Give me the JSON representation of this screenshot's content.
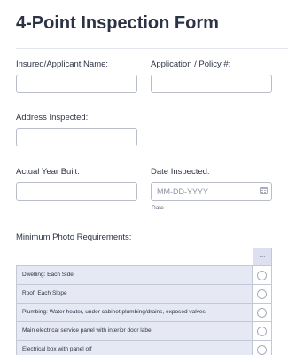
{
  "form": {
    "title": "4-Point Inspection Form"
  },
  "fields": {
    "insured_name": {
      "label": "Insured/Applicant Name:",
      "value": ""
    },
    "policy_number": {
      "label": "Application / Policy #:",
      "value": ""
    },
    "address": {
      "label": "Address Inspected:",
      "value": ""
    },
    "year_built": {
      "label": "Actual Year Built:",
      "value": ""
    },
    "date_inspected": {
      "label": "Date Inspected:",
      "placeholder": "MM-DD-YYYY",
      "sublabel": "Date",
      "icon": "calendar-icon"
    }
  },
  "photos": {
    "label": "Minimum Photo Requirements:",
    "column_header": "...",
    "rows": [
      "Dwelling: Each Side",
      "Roof: Each Slope",
      "Plumbing: Water heater, under cabinet plumbing/drains, exposed valves",
      "Main electrical service panel with interior door label",
      "Electrical box with panel off"
    ]
  },
  "colors": {
    "text": "#2c3345",
    "row_background": "#e6e9f4",
    "border": "#b8bdc9"
  }
}
